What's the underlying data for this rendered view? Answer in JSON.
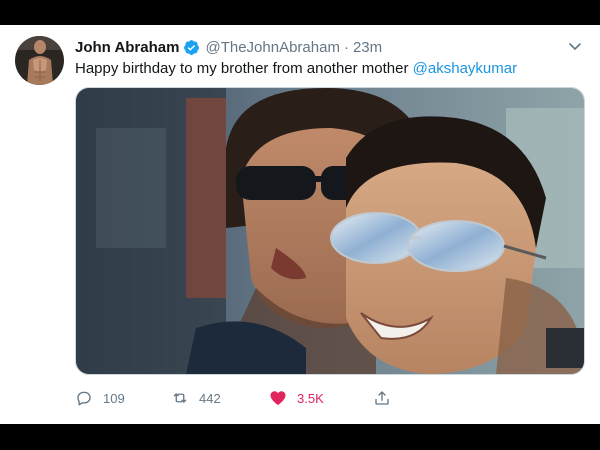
{
  "colors": {
    "mention": "#1b95e0",
    "verified": "#1da1f2",
    "like_active": "#e0245e",
    "secondary_text": "#657786"
  },
  "tweet": {
    "author": {
      "display_name": "John Abraham",
      "handle": "@TheJohnAbraham",
      "verified_icon": "verified-badge-icon",
      "avatar_icon": "avatar"
    },
    "separator": "·",
    "time": "23m",
    "text_plain": "Happy birthday to my brother from another mother ",
    "mention": "@akshaykumar",
    "menu_icon": "chevron-down-icon",
    "actions": {
      "reply": {
        "icon": "reply-icon",
        "count": "109"
      },
      "retweet": {
        "icon": "retweet-icon",
        "count": "442"
      },
      "like": {
        "icon": "heart-icon",
        "count": "3.5K",
        "active": true
      },
      "share": {
        "icon": "share-icon"
      }
    }
  }
}
